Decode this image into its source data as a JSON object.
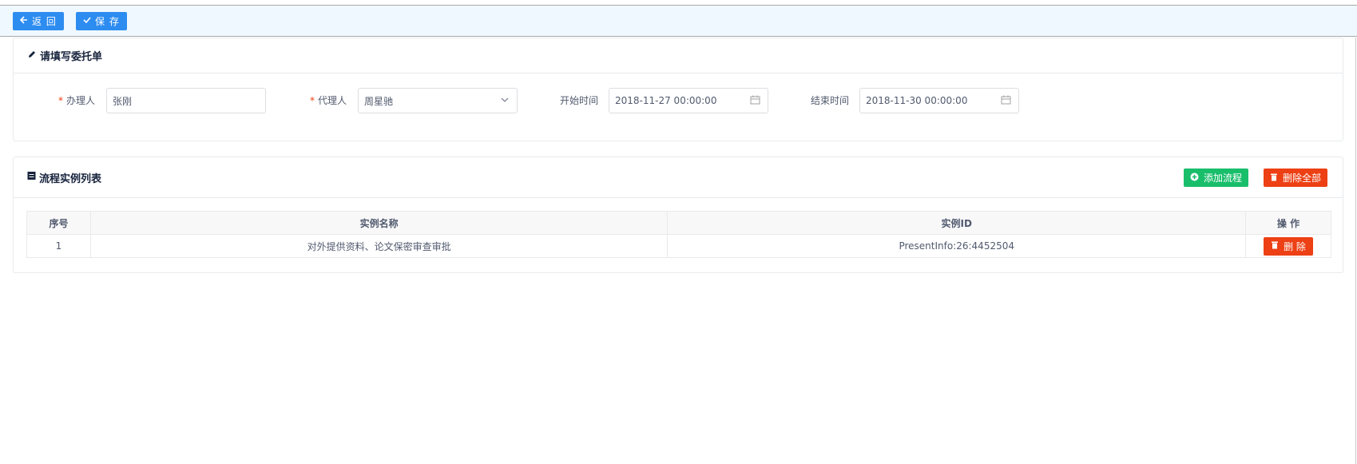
{
  "toolbar": {
    "back_label": "返 回",
    "save_label": "保 存"
  },
  "form_card": {
    "title": "请填写委托单",
    "handler_label": "办理人",
    "handler_value": "张刚",
    "agent_label": "代理人",
    "agent_value": "周星驰",
    "start_label": "开始时间",
    "start_value": "2018-11-27 00:00:00",
    "end_label": "结束时间",
    "end_value": "2018-11-30 00:00:00"
  },
  "list_card": {
    "title": "流程实例列表",
    "add_label": "添加流程",
    "delete_all_label": "删除全部",
    "columns": [
      "序号",
      "实例名称",
      "实例ID",
      "操 作"
    ],
    "rows": [
      {
        "index": "1",
        "name": "对外提供资料、论文保密审查审批",
        "id": "PresentInfo:26:4452504",
        "action": "删 除"
      }
    ]
  },
  "colors": {
    "primary": "#2d8cf0",
    "success": "#19be6b",
    "error": "#ed4014"
  }
}
